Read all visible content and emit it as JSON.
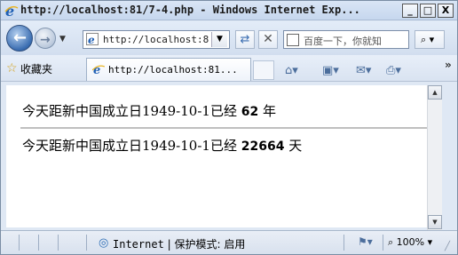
{
  "window": {
    "title": "http://localhost:81/7-4.php - Windows Internet Exp...",
    "min_label": "_",
    "max_label": "□",
    "close_label": "X"
  },
  "nav": {
    "address": "http://localhost:8",
    "search_placeholder": "百度一下，你就知"
  },
  "favorites": {
    "label": "收藏夹",
    "tab_title": "http://localhost:81..."
  },
  "content": {
    "line1_prefix": "今天距新中国成立日1949-10-1已经",
    "line1_value": "62",
    "line1_unit": "年",
    "line2_prefix": "今天距新中国成立日1949-10-1已经",
    "line2_value": "22664",
    "line2_unit": "天"
  },
  "status": {
    "zone": "Internet",
    "divider": "|",
    "protected_mode": "保护模式: 启用",
    "zoom": "100%"
  },
  "icons": {
    "back": "back-arrow-icon",
    "forward": "forward-arrow-icon",
    "refresh": "refresh-icon",
    "stop": "stop-icon",
    "search": "search-icon",
    "favorites": "star-icon",
    "home": "home-icon",
    "feeds": "rss-icon",
    "mail": "mail-icon",
    "print": "print-icon",
    "globe": "globe-icon",
    "zoom": "magnifier-icon"
  },
  "colors": {
    "ie_blue": "#1f5fb4",
    "frame": "#dfe8f4"
  }
}
